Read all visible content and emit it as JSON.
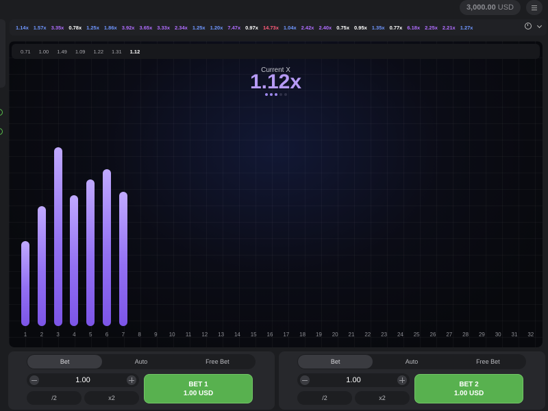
{
  "header": {
    "balance_amount": "3,000.00",
    "balance_currency": "USD",
    "menu_icon": "hamburger-icon"
  },
  "history": {
    "multipliers": [
      {
        "text": "1.14x",
        "color": "#6f96ff"
      },
      {
        "text": "1.57x",
        "color": "#6f96ff"
      },
      {
        "text": "3.35x",
        "color": "#b06dff"
      },
      {
        "text": "0.78x",
        "color": "#ffffff"
      },
      {
        "text": "1.25x",
        "color": "#6f96ff"
      },
      {
        "text": "1.86x",
        "color": "#6f96ff"
      },
      {
        "text": "3.92x",
        "color": "#b06dff"
      },
      {
        "text": "3.65x",
        "color": "#b06dff"
      },
      {
        "text": "3.33x",
        "color": "#b06dff"
      },
      {
        "text": "2.34x",
        "color": "#b06dff"
      },
      {
        "text": "1.25x",
        "color": "#6f96ff"
      },
      {
        "text": "1.20x",
        "color": "#6f96ff"
      },
      {
        "text": "7.47x",
        "color": "#b06dff"
      },
      {
        "text": "0.97x",
        "color": "#ffffff"
      },
      {
        "text": "14.73x",
        "color": "#ff5c7a"
      },
      {
        "text": "1.04x",
        "color": "#6f96ff"
      },
      {
        "text": "2.42x",
        "color": "#b06dff"
      },
      {
        "text": "2.40x",
        "color": "#b06dff"
      },
      {
        "text": "0.75x",
        "color": "#ffffff"
      },
      {
        "text": "0.95x",
        "color": "#ffffff"
      },
      {
        "text": "1.35x",
        "color": "#6f96ff"
      },
      {
        "text": "0.77x",
        "color": "#ffffff"
      },
      {
        "text": "6.18x",
        "color": "#b06dff"
      },
      {
        "text": "2.25x",
        "color": "#b06dff"
      },
      {
        "text": "2.21x",
        "color": "#b06dff"
      },
      {
        "text": "1.27x",
        "color": "#6f96ff"
      }
    ],
    "history_icon": "clock-icon",
    "expand_icon": "chevron-down-icon"
  },
  "game": {
    "recent_values": [
      "0.71",
      "1.00",
      "1.49",
      "1.09",
      "1.22",
      "1.31",
      "1.12"
    ],
    "current_label": "Current X",
    "current_value": "1.12x",
    "round_dots": {
      "total": 5,
      "active": 3
    },
    "bar_color": "#9270f2",
    "round_slots": [
      "1",
      "2",
      "3",
      "4",
      "5",
      "6",
      "7",
      "8",
      "9",
      "10",
      "11",
      "12",
      "13",
      "14",
      "15",
      "16",
      "17",
      "18",
      "19",
      "20",
      "21",
      "22",
      "23",
      "24",
      "25",
      "26",
      "27",
      "28",
      "29",
      "30",
      "31",
      "32"
    ]
  },
  "chart_data": {
    "type": "bar",
    "categories": [
      "1",
      "2",
      "3",
      "4",
      "5",
      "6",
      "7"
    ],
    "values": [
      0.71,
      1.0,
      1.49,
      1.09,
      1.22,
      1.31,
      1.12
    ],
    "ylim": [
      0,
      1.57
    ]
  },
  "bet_panels": [
    {
      "tabs": [
        "Bet",
        "Auto",
        "Free Bet"
      ],
      "active_tab": "Bet",
      "amount": "1.00",
      "half_label": "/2",
      "double_label": "x2",
      "button_title": "BET 1",
      "button_amount": "1.00 USD"
    },
    {
      "tabs": [
        "Bet",
        "Auto",
        "Free Bet"
      ],
      "active_tab": "Bet",
      "amount": "1.00",
      "half_label": "/2",
      "double_label": "x2",
      "button_title": "BET 2",
      "button_amount": "1.00 USD"
    }
  ],
  "colors": {
    "accent": "#b69af5",
    "bet_button": "#58b14f"
  }
}
